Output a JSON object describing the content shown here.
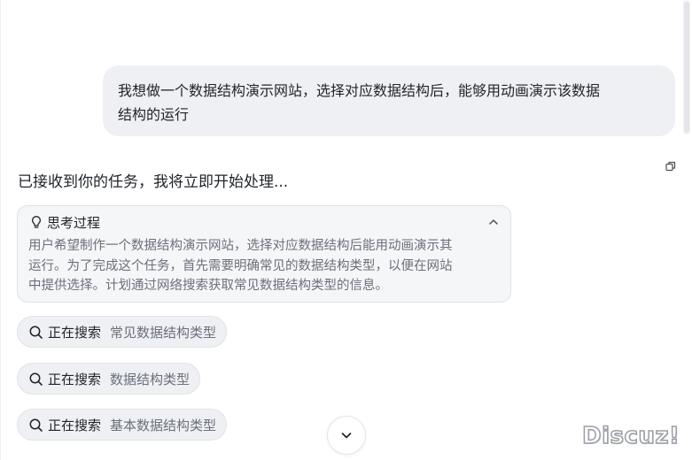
{
  "conversation": {
    "user_message": {
      "line1": "我想做一个数据结构演示网站，选择对应数据结构后，能够用动画演示该数据",
      "line2": "结构的运行"
    },
    "assistant": {
      "reply": "已接收到你的任务，我将立即开始处理...",
      "thinking": {
        "title": "思考过程",
        "lines": [
          "用户希望制作一个数据结构演示网站，选择对应数据结构后能用动画演示其",
          "运行。为了完成这个任务，首先需要明确常见的数据结构类型，以便在网站",
          "中提供选择。计划通过网络搜索获取常见数据结构类型的信息。"
        ]
      },
      "searches": [
        {
          "status": "正在搜索",
          "query": "常见数据结构类型"
        },
        {
          "status": "正在搜索",
          "query": "数据结构类型"
        },
        {
          "status": "正在搜索",
          "query": "基本数据结构类型"
        }
      ]
    }
  },
  "icons": {
    "copy": "copy-icon",
    "thinking": "lightbulb-icon",
    "collapse": "chevron-up-icon",
    "search": "search-icon",
    "scroll_down": "chevron-down-icon"
  },
  "watermark": "Discuz!",
  "colors": {
    "bubble_bg": "#eef0f4",
    "thinking_bg": "#f5f6f8",
    "muted_text": "#6b7079",
    "primary_text": "#1f2329"
  }
}
